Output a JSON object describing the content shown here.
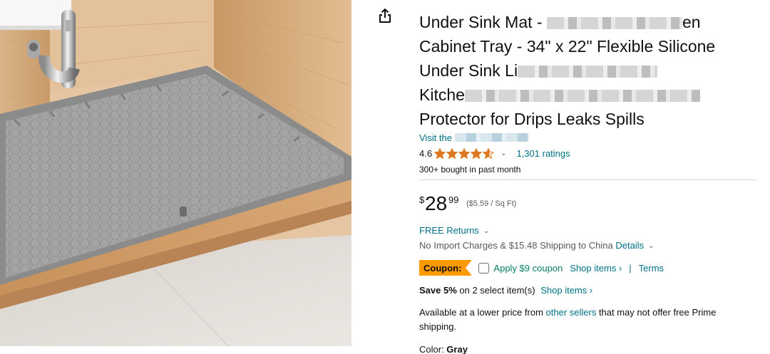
{
  "product_image": {
    "alt": "Gray silicone under sink mat in cabinet"
  },
  "share": {
    "icon": "share-icon"
  },
  "title": {
    "line1": "Under Sink Mat - ",
    "line1_tail": "en",
    "line2": "Cabinet Tray - 34\" x 22\" Flexible Silicone",
    "line3": "Under Sink Li",
    "line4": "Kitche",
    "line5": "Protector for Drips Leaks Spills"
  },
  "store": {
    "prefix": "Visit the"
  },
  "rating": {
    "value": "4.6",
    "stars_out_of_5": 4.6,
    "count_text": "1,301 ratings",
    "star_color": "#de7921"
  },
  "bought": "300+ bought in past month",
  "price": {
    "symbol": "$",
    "whole": "28",
    "fraction": "99",
    "per_unit": "($5.59 / Sq Ft)"
  },
  "returns": {
    "label": "FREE Returns"
  },
  "shipping": {
    "text": "No Import Charges & $15.48 Shipping to China",
    "details_label": "Details"
  },
  "coupon": {
    "badge": "Coupon:",
    "badge_color": "#ff9900",
    "label": "Apply $9 coupon",
    "shop_items": "Shop items ›",
    "separator": "|",
    "terms": "Terms",
    "checked": false
  },
  "save": {
    "bold": "Save 5%",
    "text": " on 2 select item(s)",
    "shop_items": "Shop items ›"
  },
  "other_sellers": {
    "prefix": "Available at a lower price from ",
    "link": "other sellers",
    "suffix": " that may not offer free Prime shipping."
  },
  "color": {
    "label": "Color: ",
    "value": "Gray"
  },
  "colors": {
    "link": "#007185",
    "green": "#067d62",
    "muted": "#565959"
  }
}
